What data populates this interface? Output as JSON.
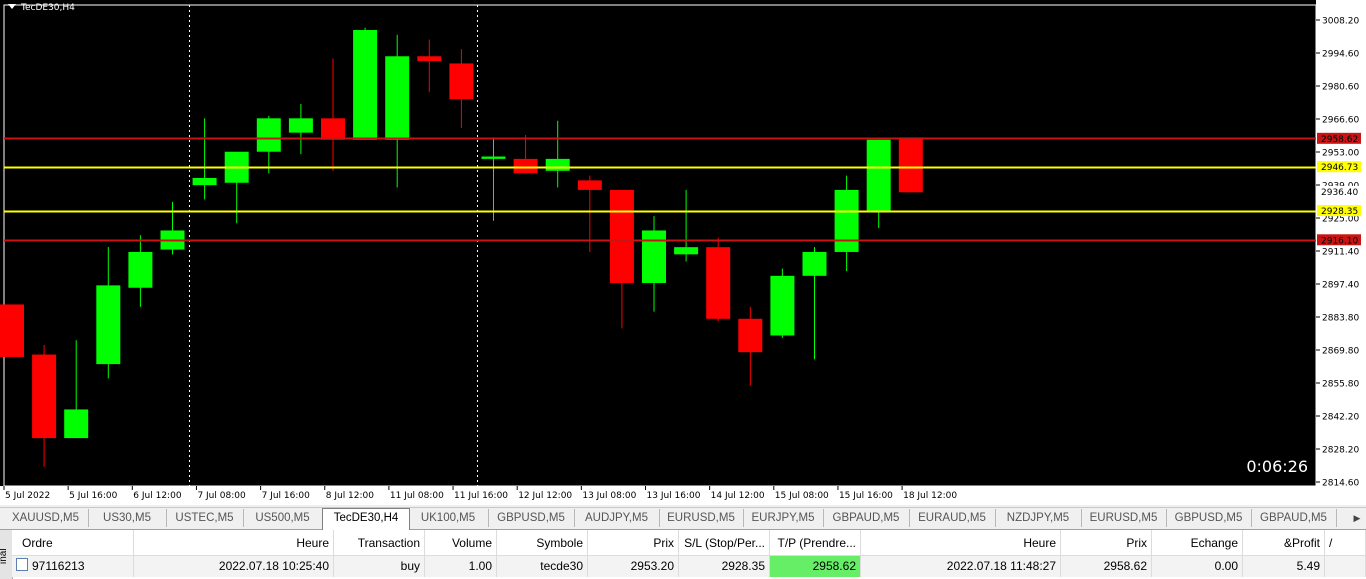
{
  "chart": {
    "symbol_label": "TecDE30,H4",
    "countdown": "0:06:26",
    "colors": {
      "background": "#000000",
      "bull": "#00ff00",
      "bear": "#ff0000",
      "wick": "#00ff00",
      "sl_line": "#ffff00",
      "tp_line": "#c81414",
      "axis_text": "#000000",
      "axis_bg": "#ffffff",
      "grid_sep": "#ffffff"
    },
    "price_axis": {
      "min": 2814.6,
      "max": 3008.2,
      "ticks": [
        "3008.20",
        "2994.60",
        "2980.60",
        "2966.60",
        "2953.00",
        "2939.00",
        "2925.00",
        "2911.40",
        "2897.40",
        "2883.80",
        "2869.80",
        "2855.80",
        "2842.20",
        "2828.20",
        "2814.60"
      ]
    },
    "time_axis": [
      "5 Jul 2022",
      "5 Jul 16:00",
      "6 Jul 12:00",
      "7 Jul 08:00",
      "7 Jul 16:00",
      "8 Jul 12:00",
      "11 Jul 08:00",
      "11 Jul 16:00",
      "12 Jul 12:00",
      "13 Jul 08:00",
      "13 Jul 16:00",
      "14 Jul 12:00",
      "15 Jul 08:00",
      "15 Jul 16:00",
      "18 Jul 12:00"
    ],
    "price_tags": [
      {
        "label": "2958.62",
        "price": 2958.62,
        "bg": "#c81414",
        "fg": "#000000"
      },
      {
        "label": "2946.73",
        "price": 2946.73,
        "bg": "#ffff00",
        "fg": "#000000"
      },
      {
        "label": "2936.40",
        "price": 2936.4,
        "bg": "#ffffff",
        "fg": "#000000"
      },
      {
        "label": "2928.35",
        "price": 2928.35,
        "bg": "#ffff00",
        "fg": "#000000"
      },
      {
        "label": "2916.10",
        "price": 2916.1,
        "bg": "#c81414",
        "fg": "#000000"
      }
    ],
    "hlines": [
      {
        "price": 2958.62,
        "color": "#c81414"
      },
      {
        "price": 2946.73,
        "color": "#ffff00"
      },
      {
        "price": 2928.35,
        "color": "#ffff00"
      },
      {
        "price": 2916.1,
        "color": "#c81414"
      }
    ],
    "period_separators": [
      6,
      15
    ],
    "candles": [
      {
        "o": 2889,
        "h": 2889,
        "l": 2867,
        "c": 2867
      },
      {
        "o": 2868,
        "h": 2872,
        "l": 2821,
        "c": 2833
      },
      {
        "o": 2833,
        "h": 2874,
        "l": 2833,
        "c": 2845
      },
      {
        "o": 2864,
        "h": 2913,
        "l": 2858,
        "c": 2897
      },
      {
        "o": 2896,
        "h": 2918,
        "l": 2888,
        "c": 2911
      },
      {
        "o": 2912,
        "h": 2932,
        "l": 2910,
        "c": 2920
      },
      {
        "o": 2939,
        "h": 2967,
        "l": 2933,
        "c": 2942
      },
      {
        "o": 2940,
        "h": 2947,
        "l": 2923,
        "c": 2953
      },
      {
        "o": 2953,
        "h": 2968,
        "l": 2944,
        "c": 2967
      },
      {
        "o": 2961,
        "h": 2973,
        "l": 2952,
        "c": 2967
      },
      {
        "o": 2967,
        "h": 2992,
        "l": 2945,
        "c": 2958
      },
      {
        "o": 2958,
        "h": 3005,
        "l": 2958,
        "c": 3004
      },
      {
        "o": 2958,
        "h": 3002,
        "l": 2938,
        "c": 2993
      },
      {
        "o": 2993,
        "h": 3000,
        "l": 2978,
        "c": 2991
      },
      {
        "o": 2990,
        "h": 2996,
        "l": 2963,
        "c": 2975
      },
      {
        "o": 2950,
        "h": 2959,
        "l": 2924,
        "c": 2951
      },
      {
        "o": 2950,
        "h": 2960,
        "l": 2944,
        "c": 2944
      },
      {
        "o": 2945,
        "h": 2966,
        "l": 2938,
        "c": 2950
      },
      {
        "o": 2941,
        "h": 2943,
        "l": 2911,
        "c": 2937
      },
      {
        "o": 2937,
        "h": 2937,
        "l": 2879,
        "c": 2898
      },
      {
        "o": 2898,
        "h": 2926,
        "l": 2886,
        "c": 2920
      },
      {
        "o": 2910,
        "h": 2937,
        "l": 2907,
        "c": 2913
      },
      {
        "o": 2913,
        "h": 2917,
        "l": 2882,
        "c": 2883
      },
      {
        "o": 2883,
        "h": 2888,
        "l": 2855,
        "c": 2869
      },
      {
        "o": 2876,
        "h": 2904,
        "l": 2875,
        "c": 2901
      },
      {
        "o": 2901,
        "h": 2913,
        "l": 2866,
        "c": 2911
      },
      {
        "o": 2911,
        "h": 2943,
        "l": 2903,
        "c": 2937
      },
      {
        "o": 2928,
        "h": 2958,
        "l": 2921,
        "c": 2958
      },
      {
        "o": 2959,
        "h": 2959,
        "l": 2936,
        "c": 2936
      }
    ]
  },
  "tabs": [
    {
      "label": "XAUUSD,M5",
      "active": false
    },
    {
      "label": "US30,M5",
      "active": false
    },
    {
      "label": "USTEC,M5",
      "active": false
    },
    {
      "label": "US500,M5",
      "active": false
    },
    {
      "label": "TecDE30,H4",
      "active": true
    },
    {
      "label": "UK100,M5",
      "active": false
    },
    {
      "label": "GBPUSD,M5",
      "active": false
    },
    {
      "label": "AUDJPY,M5",
      "active": false
    },
    {
      "label": "EURUSD,M5",
      "active": false
    },
    {
      "label": "EURJPY,M5",
      "active": false
    },
    {
      "label": "GBPAUD,M5",
      "active": false
    },
    {
      "label": "EURAUD,M5",
      "active": false
    },
    {
      "label": "NZDJPY,M5",
      "active": false
    },
    {
      "label": "EURUSD,M5",
      "active": false
    },
    {
      "label": "GBPUSD,M5",
      "active": false
    },
    {
      "label": "GBPAUD,M5",
      "active": false
    }
  ],
  "terminal": {
    "side_label": "inal",
    "headers": [
      "Ordre",
      "Heure",
      "Transaction",
      "Volume",
      "Symbole",
      "Prix",
      "S/L (Stop/Per...",
      "T/P (Prendre...",
      "Heure",
      "Prix",
      "Echange",
      "&Profit",
      "/"
    ],
    "row": {
      "order": "97116213",
      "open_time": "2022.07.18 10:25:40",
      "type": "buy",
      "volume": "1.00",
      "symbol": "tecde30",
      "open_price": "2953.20",
      "sl": "2928.35",
      "tp": "2958.62",
      "close_time": "2022.07.18 11:48:27",
      "close_price": "2958.62",
      "swap": "0.00",
      "profit": "5.49"
    }
  }
}
